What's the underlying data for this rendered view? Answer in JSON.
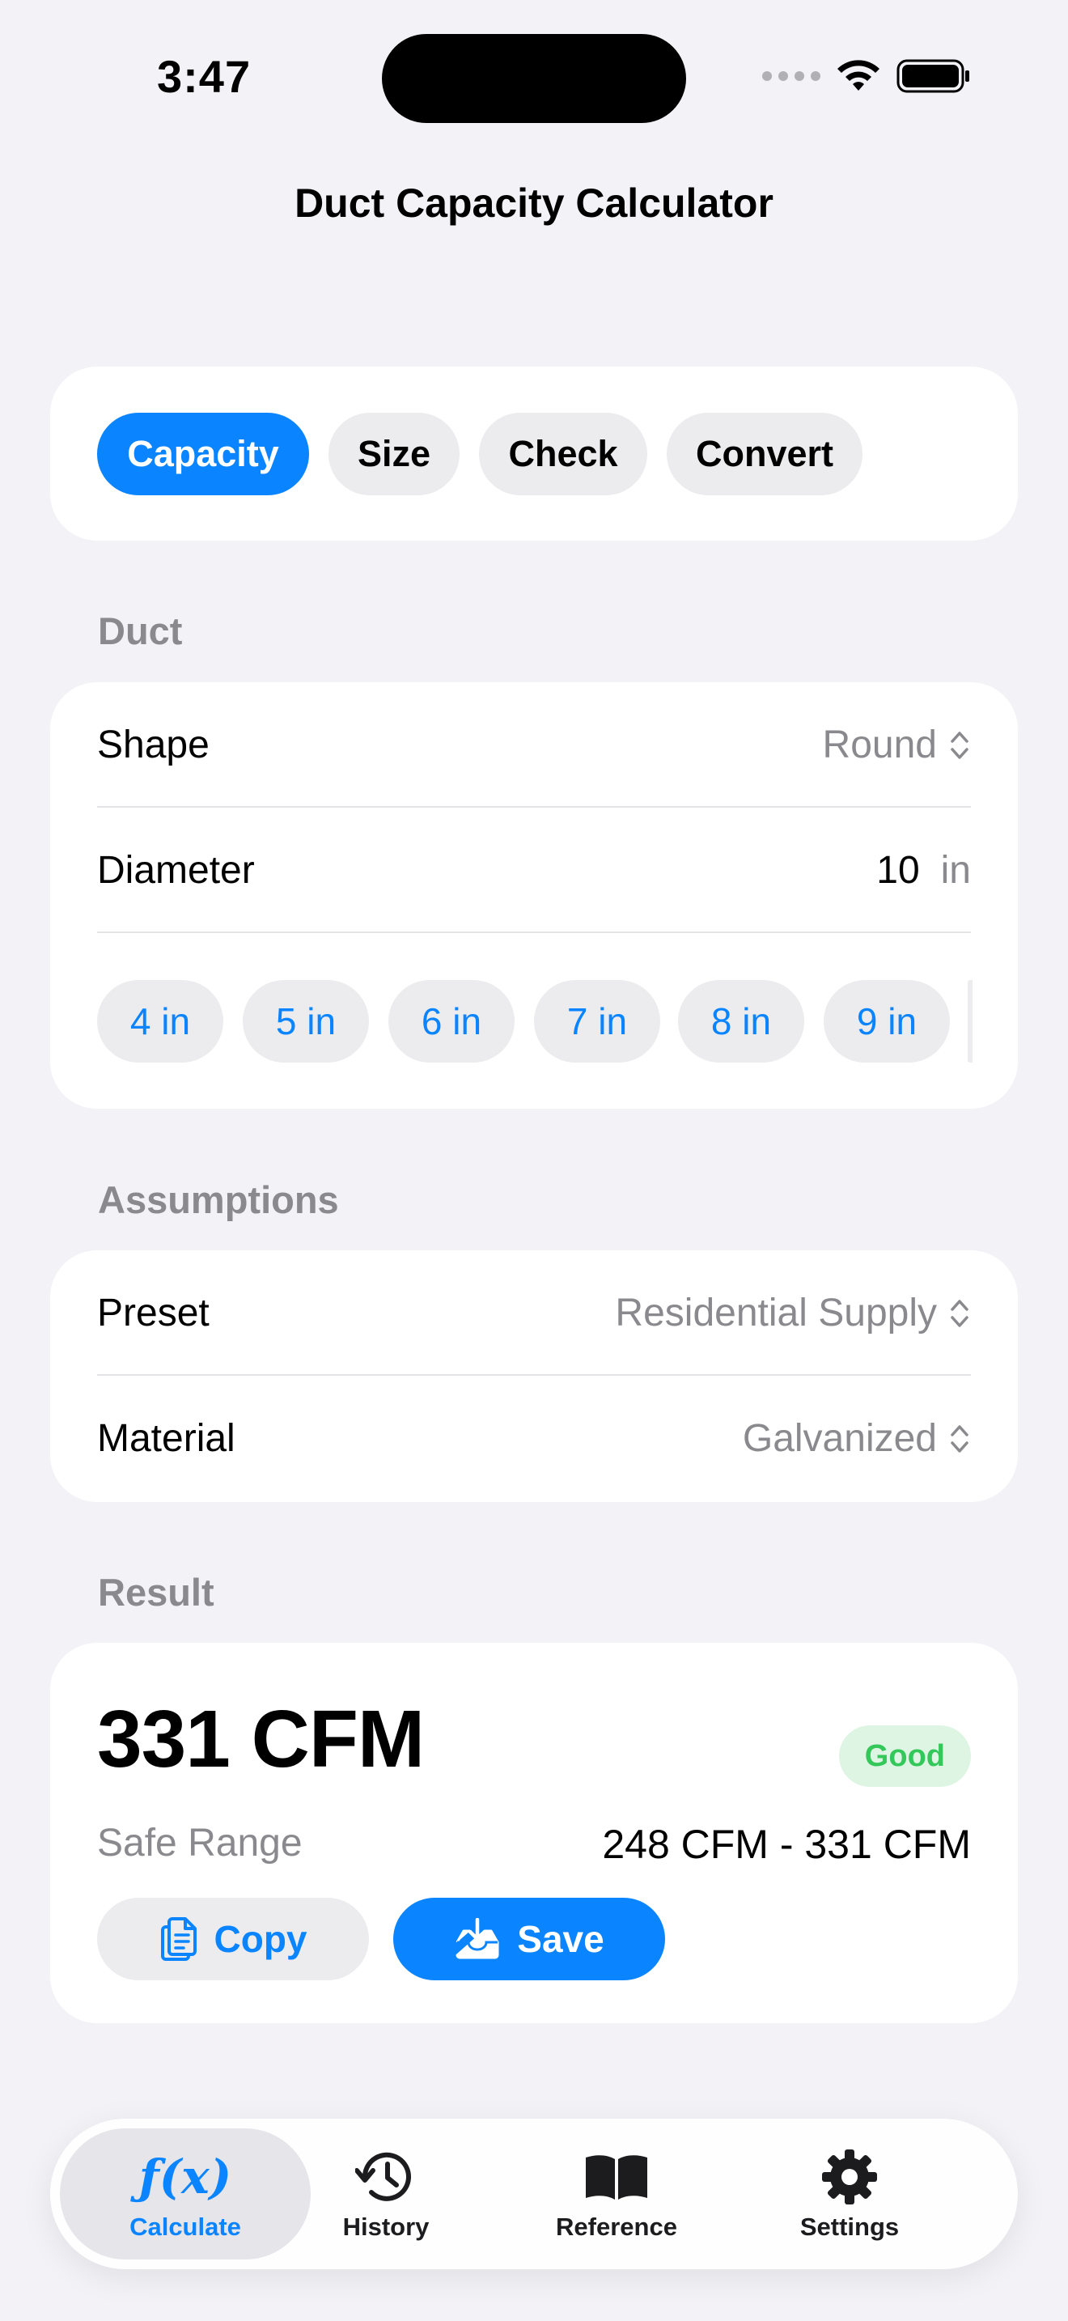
{
  "status_bar": {
    "time": "3:47"
  },
  "nav": {
    "title": "Duct Capacity Calculator"
  },
  "segments": [
    {
      "label": "Capacity",
      "active": true
    },
    {
      "label": "Size",
      "active": false
    },
    {
      "label": "Check",
      "active": false
    },
    {
      "label": "Convert",
      "active": false
    }
  ],
  "duct": {
    "section_label": "Duct",
    "shape_label": "Shape",
    "shape_value": "Round",
    "diameter_label": "Diameter",
    "diameter_value": "10",
    "diameter_unit": "in",
    "chips": [
      "4 in",
      "5 in",
      "6 in",
      "7 in",
      "8 in",
      "9 in"
    ]
  },
  "assumptions": {
    "section_label": "Assumptions",
    "preset_label": "Preset",
    "preset_value": "Residential Supply",
    "material_label": "Material",
    "material_value": "Galvanized"
  },
  "result": {
    "section_label": "Result",
    "value": "331 CFM",
    "badge": "Good",
    "range_label": "Safe Range",
    "range_value": "248 CFM - 331 CFM",
    "copy_label": "Copy",
    "save_label": "Save"
  },
  "tabbar": {
    "items": [
      {
        "label": "Calculate",
        "icon": "fx-icon",
        "active": true
      },
      {
        "label": "History",
        "icon": "history-icon",
        "active": false
      },
      {
        "label": "Reference",
        "icon": "book-icon",
        "active": false
      },
      {
        "label": "Settings",
        "icon": "gear-icon",
        "active": false
      }
    ],
    "fx_glyph": "ƒ(x)"
  },
  "colors": {
    "accent": "#0a84ff",
    "good": "#34c759",
    "background": "#f2f2f7"
  }
}
